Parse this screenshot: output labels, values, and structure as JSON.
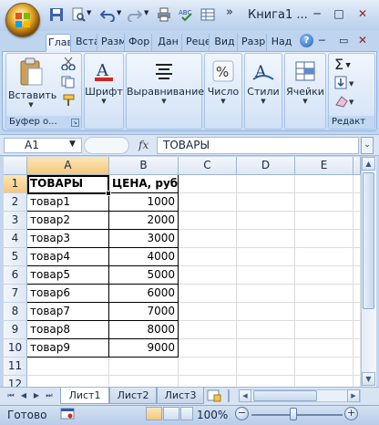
{
  "window": {
    "title": "Книга1 ...",
    "minimize": "─",
    "maximize": "□",
    "close": "✕"
  },
  "tabs": [
    "Глав",
    "Вста",
    "Разм",
    "Фор",
    "Дан",
    "Рецє",
    "Вид",
    "Разр",
    "Над"
  ],
  "ribbon": {
    "paste_label": "Вставить",
    "clipboard_group": "Буфер о...",
    "font_label": "Шрифт",
    "alignment_label": "Выравнивание",
    "number_label": "Число",
    "styles_label": "Стили",
    "cells_label": "Ячейки",
    "editing_group": "Редакт"
  },
  "formula_bar": {
    "name_box": "A1",
    "fx": "fx",
    "content": "ТОВАРЫ"
  },
  "columns": [
    "A",
    "B",
    "C",
    "D",
    "E"
  ],
  "rows": [
    "1",
    "2",
    "3",
    "4",
    "5",
    "6",
    "7",
    "8",
    "9",
    "10",
    "11",
    "12"
  ],
  "cells": {
    "a1": "ТОВАРЫ",
    "b1": "ЦЕНА, руб.",
    "items": [
      {
        "name": "товар1",
        "price": "1000"
      },
      {
        "name": "товар2",
        "price": "2000"
      },
      {
        "name": "товар3",
        "price": "3000"
      },
      {
        "name": "товар4",
        "price": "4000"
      },
      {
        "name": "товар5",
        "price": "5000"
      },
      {
        "name": "товар6",
        "price": "6000"
      },
      {
        "name": "товар7",
        "price": "7000"
      },
      {
        "name": "товар8",
        "price": "8000"
      },
      {
        "name": "товар9",
        "price": "9000"
      }
    ]
  },
  "sheets": [
    "Лист1",
    "Лист2",
    "Лист3"
  ],
  "status": {
    "ready": "Готово",
    "zoom": "100%"
  },
  "colors": {
    "accent": "#1f5fb3",
    "selection_header": "#f4c87b"
  }
}
